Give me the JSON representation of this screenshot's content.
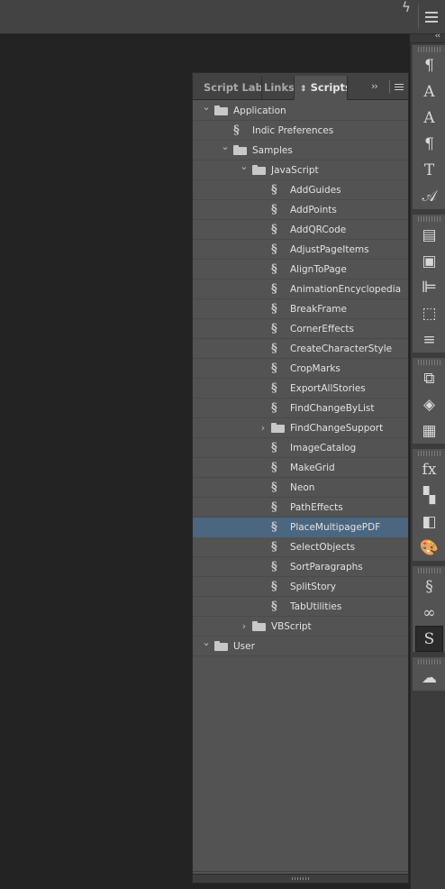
{
  "panel": {
    "tabs": [
      {
        "label": "Script Labe"
      },
      {
        "label": "Links"
      },
      {
        "label": "Scripts"
      }
    ],
    "more_glyph": "››"
  },
  "tree": [
    {
      "label": "Application",
      "kind": "folder",
      "depth": 0,
      "expanded": true
    },
    {
      "label": "Indic Preferences",
      "kind": "script",
      "depth": 1
    },
    {
      "label": "Samples",
      "kind": "folder",
      "depth": 1,
      "expanded": true
    },
    {
      "label": "JavaScript",
      "kind": "folder",
      "depth": 2,
      "expanded": true
    },
    {
      "label": "AddGuides",
      "kind": "script",
      "depth": 3
    },
    {
      "label": "AddPoints",
      "kind": "script",
      "depth": 3
    },
    {
      "label": "AddQRCode",
      "kind": "script",
      "depth": 3
    },
    {
      "label": "AdjustPageItems",
      "kind": "script",
      "depth": 3
    },
    {
      "label": "AlignToPage",
      "kind": "script",
      "depth": 3
    },
    {
      "label": "AnimationEncyclopedia",
      "kind": "script",
      "depth": 3
    },
    {
      "label": "BreakFrame",
      "kind": "script",
      "depth": 3
    },
    {
      "label": "CornerEffects",
      "kind": "script",
      "depth": 3
    },
    {
      "label": "CreateCharacterStyle",
      "kind": "script",
      "depth": 3
    },
    {
      "label": "CropMarks",
      "kind": "script",
      "depth": 3
    },
    {
      "label": "ExportAllStories",
      "kind": "script",
      "depth": 3
    },
    {
      "label": "FindChangeByList",
      "kind": "script",
      "depth": 3
    },
    {
      "label": "FindChangeSupport",
      "kind": "folder",
      "depth": 3,
      "expanded": false
    },
    {
      "label": "ImageCatalog",
      "kind": "script",
      "depth": 3
    },
    {
      "label": "MakeGrid",
      "kind": "script",
      "depth": 3
    },
    {
      "label": "Neon",
      "kind": "script",
      "depth": 3
    },
    {
      "label": "PathEffects",
      "kind": "script",
      "depth": 3
    },
    {
      "label": "PlaceMultipagePDF",
      "kind": "script",
      "depth": 3,
      "selected": true
    },
    {
      "label": "SelectObjects",
      "kind": "script",
      "depth": 3
    },
    {
      "label": "SortParagraphs",
      "kind": "script",
      "depth": 3
    },
    {
      "label": "SplitStory",
      "kind": "script",
      "depth": 3
    },
    {
      "label": "TabUtilities",
      "kind": "script",
      "depth": 3
    },
    {
      "label": "VBScript",
      "kind": "folder",
      "depth": 2,
      "expanded": false
    },
    {
      "label": "User",
      "kind": "folder",
      "depth": 0,
      "expanded": true
    }
  ],
  "dock": {
    "groups": [
      {
        "icons": [
          {
            "name": "paragraph-styles-icon",
            "glyph": "¶"
          },
          {
            "name": "character-styles-icon",
            "glyph": "A"
          },
          {
            "name": "character-icon",
            "glyph": "A"
          },
          {
            "name": "paragraph-icon",
            "glyph": "¶"
          },
          {
            "name": "type-icon",
            "glyph": "T"
          },
          {
            "name": "glyphs-icon",
            "glyph": "𝒜"
          }
        ]
      },
      {
        "icons": [
          {
            "name": "text-wrap-icon",
            "glyph": "▤"
          },
          {
            "name": "pathfinder-icon",
            "glyph": "▣"
          },
          {
            "name": "align-icon",
            "glyph": "⊫"
          },
          {
            "name": "transform-icon",
            "glyph": "⬚"
          },
          {
            "name": "stroke-icon",
            "glyph": "≡"
          }
        ]
      },
      {
        "icons": [
          {
            "name": "pages-icon",
            "glyph": "⧉"
          },
          {
            "name": "layers-icon",
            "glyph": "◈"
          },
          {
            "name": "story-editor-icon",
            "glyph": "▦"
          }
        ]
      },
      {
        "icons": [
          {
            "name": "effects-icon",
            "glyph": "fx"
          },
          {
            "name": "swatches-icon",
            "glyph": "▚"
          },
          {
            "name": "gradient-icon",
            "glyph": "◧"
          },
          {
            "name": "color-theme-icon",
            "glyph": "🎨"
          }
        ]
      },
      {
        "icons": [
          {
            "name": "script-label-icon",
            "glyph": "§"
          },
          {
            "name": "links-icon",
            "glyph": "∞"
          },
          {
            "name": "scripts-icon",
            "glyph": "S",
            "active": true
          }
        ]
      },
      {
        "icons": [
          {
            "name": "cc-libraries-icon",
            "glyph": "☁"
          }
        ]
      }
    ]
  },
  "colors": {
    "selection": "#4b6680",
    "panel_bg": "#535353",
    "app_bg": "#232323"
  }
}
